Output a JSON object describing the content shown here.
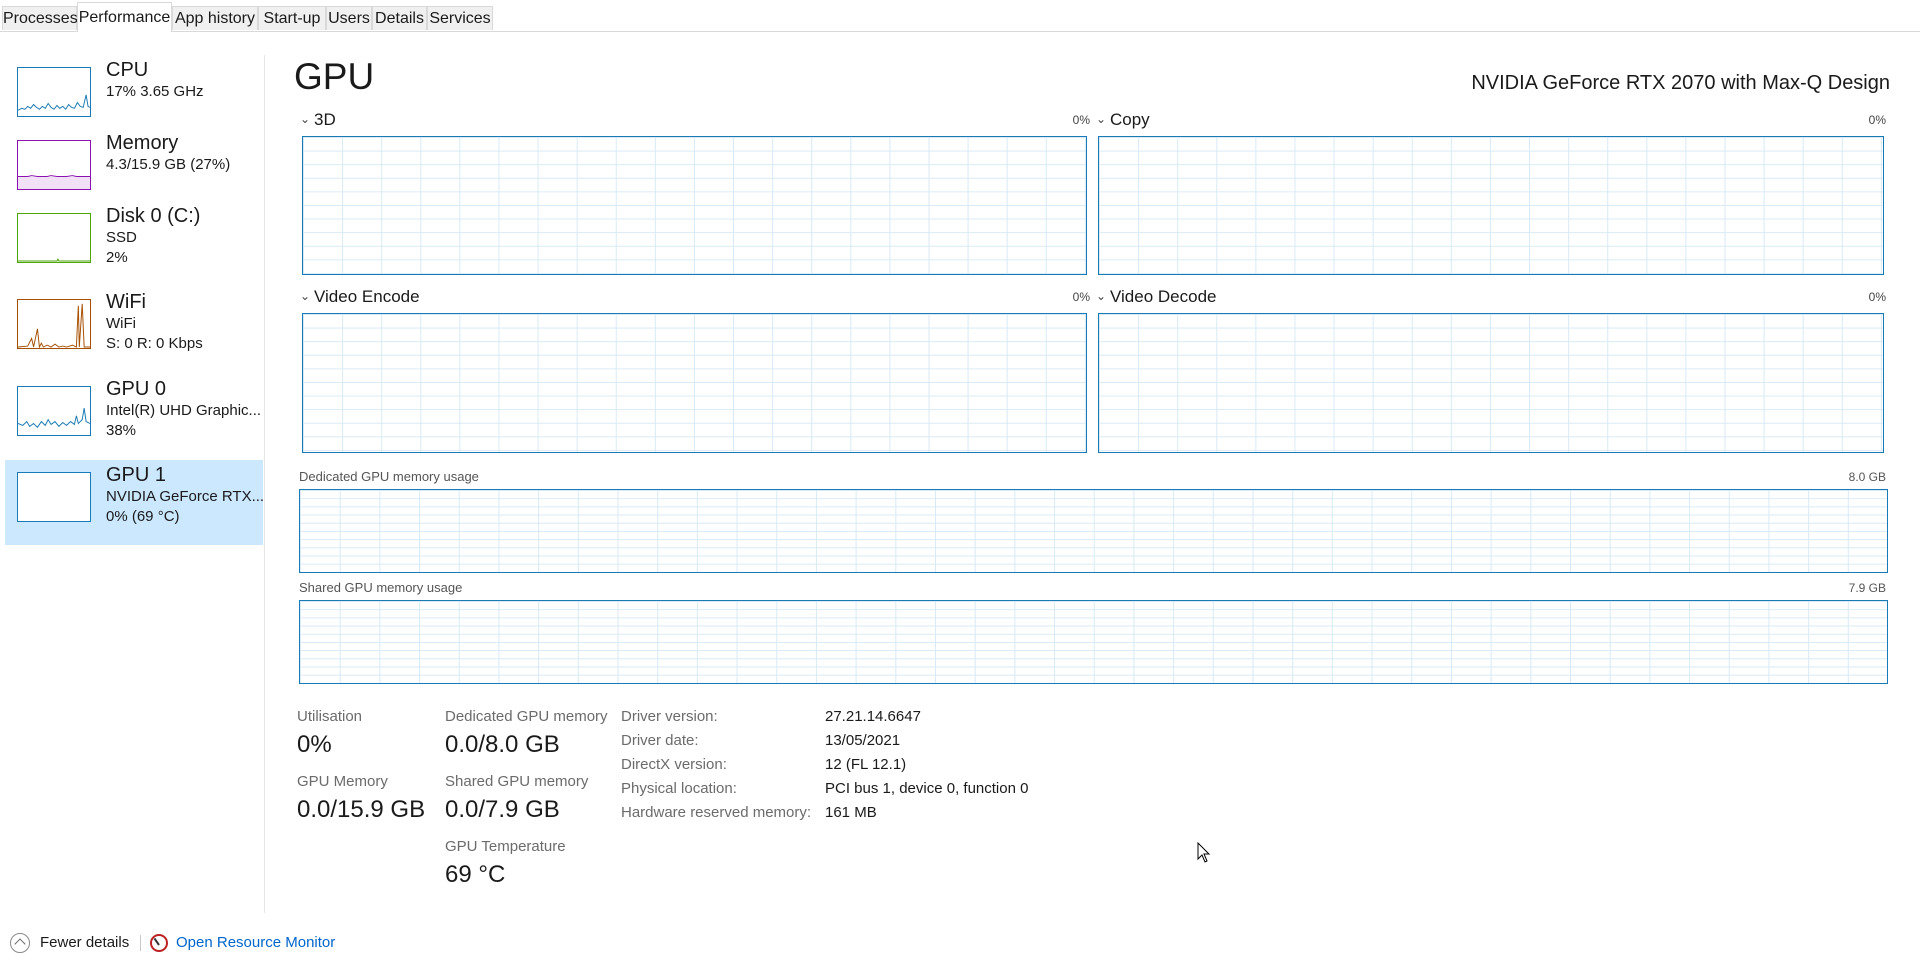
{
  "tabs": [
    {
      "label": "Processes",
      "active": false
    },
    {
      "label": "Performance",
      "active": true
    },
    {
      "label": "App history",
      "active": false
    },
    {
      "label": "Start-up",
      "active": false
    },
    {
      "label": "Users",
      "active": false
    },
    {
      "label": "Details",
      "active": false
    },
    {
      "label": "Services",
      "active": false
    }
  ],
  "sidebar": {
    "items": [
      {
        "name": "CPU",
        "line1": "17%  3.65 GHz",
        "line2": "",
        "color": "#1a7ab5",
        "icon": "cpu-usage-thumbnail"
      },
      {
        "name": "Memory",
        "line1": "4.3/15.9 GB (27%)",
        "line2": "",
        "color": "#8b12ae",
        "icon": "memory-usage-thumbnail"
      },
      {
        "name": "Disk 0 (C:)",
        "line1": "SSD",
        "line2": "2%",
        "color": "#4da60c",
        "icon": "disk-usage-thumbnail"
      },
      {
        "name": "WiFi",
        "line1": "WiFi",
        "line2": "S: 0  R: 0 Kbps",
        "color": "#a74f01",
        "icon": "wifi-usage-thumbnail"
      },
      {
        "name": "GPU 0",
        "line1": "Intel(R) UHD Graphic...",
        "line2": "38%",
        "color": "#1a7ab5",
        "icon": "gpu0-usage-thumbnail"
      },
      {
        "name": "GPU 1",
        "line1": "NVIDIA GeForce RTX...",
        "line2": "0%  (69 °C)",
        "color": "#1a7ab5",
        "icon": "gpu1-usage-thumbnail",
        "selected": true
      }
    ]
  },
  "main": {
    "title": "GPU",
    "device": "NVIDIA GeForce RTX 2070 with Max-Q Design",
    "engines": [
      {
        "label": "3D",
        "percent": "0%"
      },
      {
        "label": "Copy",
        "percent": "0%"
      },
      {
        "label": "Video Encode",
        "percent": "0%"
      },
      {
        "label": "Video Decode",
        "percent": "0%"
      }
    ],
    "dedicated_memory": {
      "label": "Dedicated GPU memory usage",
      "max": "8.0 GB"
    },
    "shared_memory": {
      "label": "Shared GPU memory usage",
      "max": "7.9 GB"
    }
  },
  "stats": {
    "utilisation_label": "Utilisation",
    "utilisation_value": "0%",
    "gpu_memory_label": "GPU Memory",
    "gpu_memory_value": "0.0/15.9 GB",
    "dedicated_label": "Dedicated GPU memory",
    "dedicated_value": "0.0/8.0 GB",
    "shared_label": "Shared GPU memory",
    "shared_value": "0.0/7.9 GB",
    "temp_label": "GPU Temperature",
    "temp_value": "69 °C"
  },
  "info": [
    {
      "label": "Driver version:",
      "value": "27.21.14.6647"
    },
    {
      "label": "Driver date:",
      "value": "13/05/2021"
    },
    {
      "label": "DirectX version:",
      "value": "12 (FL 12.1)"
    },
    {
      "label": "Physical location:",
      "value": "PCI bus 1, device 0, function 0"
    },
    {
      "label": "Hardware reserved memory:",
      "value": "161 MB"
    }
  ],
  "footer": {
    "fewer_details": "Fewer details",
    "open_resource_monitor": "Open Resource Monitor"
  },
  "colors": {
    "accent": "#1a7ab5",
    "selection": "#cce8ff",
    "link": "#0066cc"
  }
}
